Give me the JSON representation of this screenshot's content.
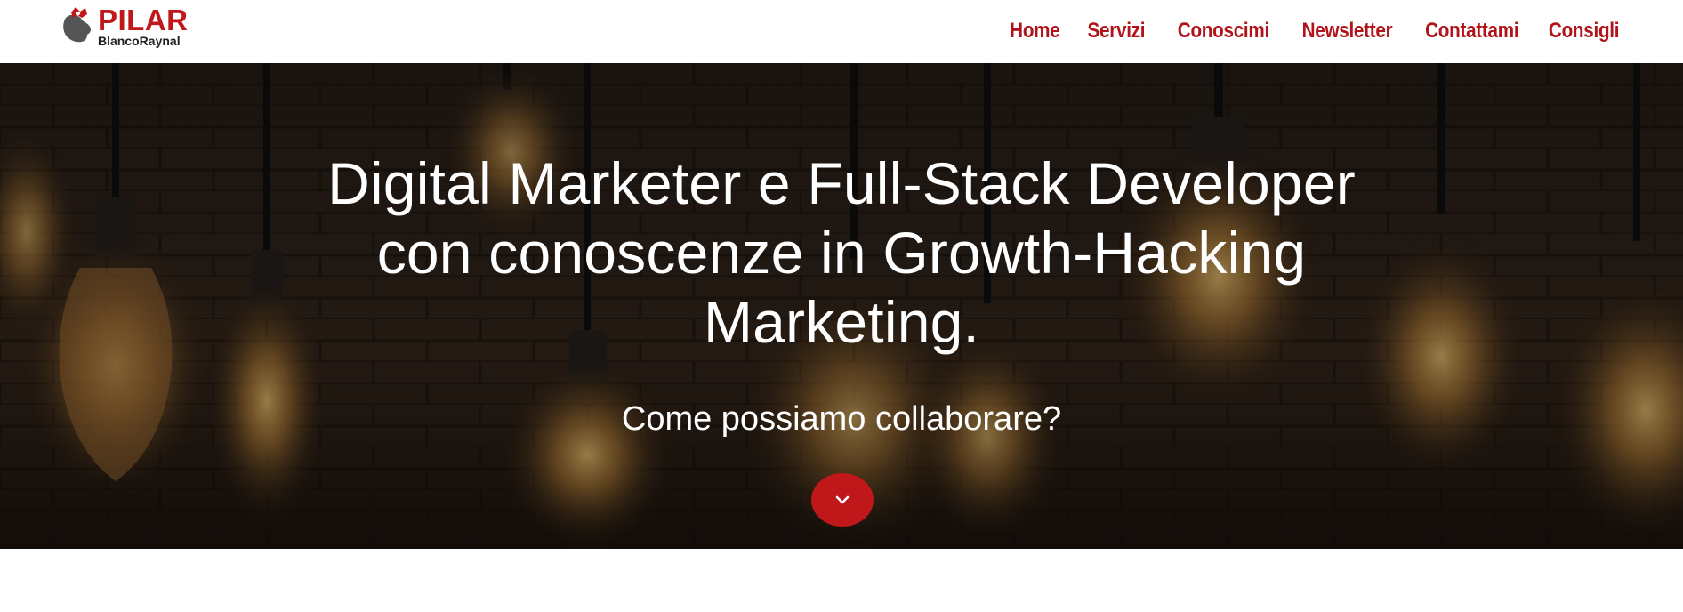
{
  "brand": {
    "name": "PILAR",
    "subname": "BlancoRaynal",
    "color": "#c0171a"
  },
  "nav": {
    "items": [
      {
        "label": "Home"
      },
      {
        "label": "Servizi"
      },
      {
        "label": "Conoscimi"
      },
      {
        "label": "Newsletter"
      },
      {
        "label": "Contattami"
      },
      {
        "label": "Consigli"
      }
    ],
    "color": "#b0141a"
  },
  "hero": {
    "title_line1": "Digital Marketer e Full-Stack Developer",
    "title_line2": "con conoscenze in Growth-Hacking",
    "title_line3": "Marketing.",
    "subtitle": "Come possiamo collaborare?",
    "scroll_icon": "chevron-down-icon",
    "background": "hanging-light-bulbs-photo",
    "accent": "#c0171a"
  }
}
